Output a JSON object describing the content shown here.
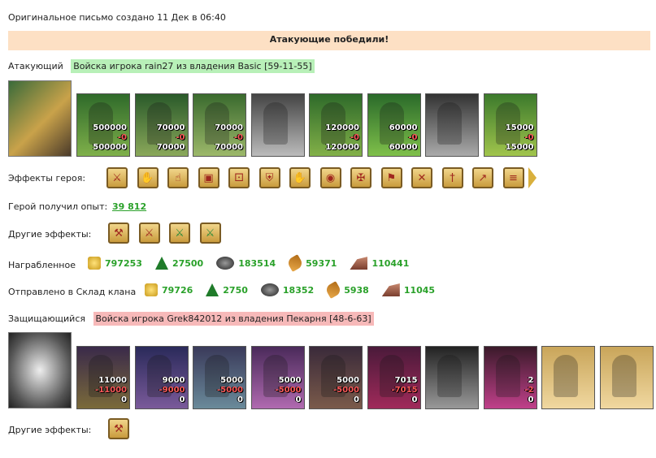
{
  "header": {
    "created": "Оригинальное письмо создано 11 Дек в 06:40",
    "result": "Атакующие победили!"
  },
  "attacker": {
    "label": "Атакующий",
    "army": "Войска игрока rain27 из владения Basic [59-11-55]",
    "units": [
      {
        "top": "500000",
        "mid": "-0",
        "bot": "500000"
      },
      {
        "top": "70000",
        "mid": "-0",
        "bot": "70000"
      },
      {
        "top": "70000",
        "mid": "-0",
        "bot": "70000"
      },
      {
        "top": "",
        "mid": "",
        "bot": ""
      },
      {
        "top": "120000",
        "mid": "-0",
        "bot": "120000"
      },
      {
        "top": "60000",
        "mid": "-0",
        "bot": "60000"
      },
      {
        "top": "",
        "mid": "",
        "bot": ""
      },
      {
        "top": "15000",
        "mid": "-0",
        "bot": "15000"
      }
    ],
    "hero_effects_label": "Эффекты героя:",
    "hero_effects_icons": [
      "sword",
      "handshake",
      "hand",
      "chest",
      "dice",
      "shield",
      "hand-shield",
      "pouch",
      "crest",
      "banner",
      "crossed-axes",
      "dagger",
      "spear",
      "scroll"
    ],
    "exp_label": "Герой получил опыт:",
    "exp_value": "39 812",
    "other_effects_label": "Другие эффекты:",
    "other_effects_icons": [
      "axe",
      "sword",
      "sword-green",
      "sword-green"
    ],
    "loot_label": "Награбленное",
    "loot": [
      "797253",
      "27500",
      "183514",
      "59371",
      "110441"
    ],
    "clan_label": "Отправлено в Склад клана",
    "clan": [
      "79726",
      "2750",
      "18352",
      "5938",
      "11045"
    ]
  },
  "defender": {
    "label": "Защищающийся",
    "army": "Войска игрока Grek842012 из владения Пекарня [48-6-63]",
    "units": [
      {
        "top": "11000",
        "mid": "-11000",
        "bot": "0"
      },
      {
        "top": "9000",
        "mid": "-9000",
        "bot": "0"
      },
      {
        "top": "5000",
        "mid": "-5000",
        "bot": "0"
      },
      {
        "top": "5000",
        "mid": "-5000",
        "bot": "0"
      },
      {
        "top": "5000",
        "mid": "-5000",
        "bot": "0"
      },
      {
        "top": "7015",
        "mid": "-7015",
        "bot": "0"
      },
      {
        "top": "",
        "mid": "",
        "bot": ""
      },
      {
        "top": "2",
        "mid": "-2",
        "bot": "0"
      },
      {
        "top": "",
        "mid": "",
        "bot": ""
      },
      {
        "top": "",
        "mid": "",
        "bot": ""
      }
    ],
    "other_effects_label": "Другие эффекты:",
    "other_effects_icons": [
      "axe"
    ]
  },
  "colors": {
    "banner": "#fde0c4",
    "attacker_hl": "#b8f0b8",
    "defender_hl": "#f7b9b9",
    "value_green": "#2aa12a"
  }
}
